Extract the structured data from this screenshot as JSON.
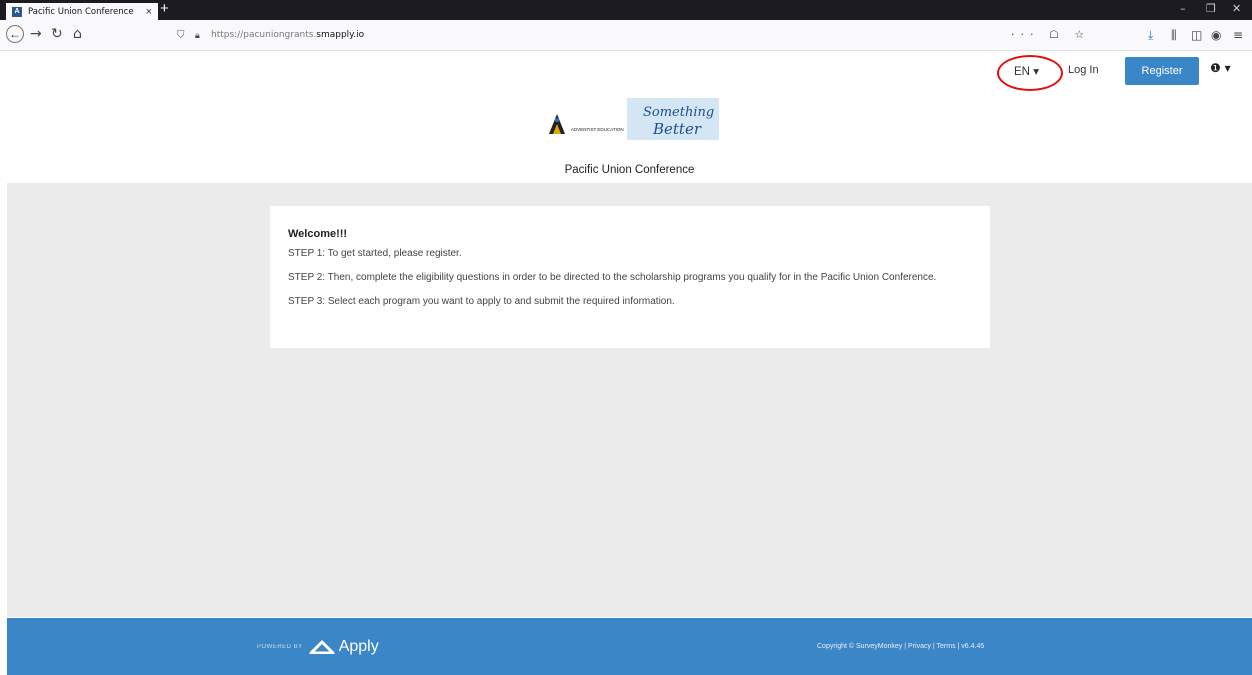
{
  "browser": {
    "tab_title": "Pacific Union Conference",
    "tab_close": "×",
    "new_tab": "+",
    "url_prefix": "https://pacuniongrants.",
    "url_host": "smapply.io",
    "url_actions": "··· ☖ ☆",
    "window_minimize": "–",
    "window_restore": "❐",
    "window_close": "✕"
  },
  "header": {
    "language": "EN",
    "login_label": "Log In",
    "register_label": "Register",
    "org_title": "Pacific Union Conference",
    "logo_text_main": "ADVENTIST EDUCATION",
    "logo_text_script": "Something Better"
  },
  "welcome": {
    "heading": "Welcome!!!",
    "step1": "STEP 1: To get started, please register.",
    "step2": "STEP 2: Then, complete the eligibility questions in order to be directed to the scholarship programs you qualify for in the Pacific Union Conference.",
    "step3": "STEP 3: Select each program you want to apply to and submit the required information."
  },
  "footer": {
    "powered_by": "POWERED BY",
    "brand": "Apply",
    "copyright": "Copyright © SurveyMonkey | Privacy | Terms | v6.4.45"
  },
  "colors": {
    "accent": "#3b86c6",
    "highlight_ring": "#e01010",
    "page_bg": "#ebebeb"
  }
}
